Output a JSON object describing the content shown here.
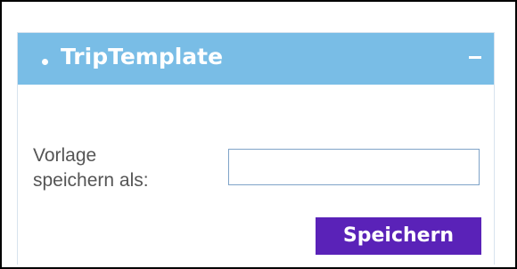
{
  "panel": {
    "title": "TripTemplate",
    "collapse_icon": "minus-icon"
  },
  "form": {
    "label": "Vorlage\nspeichern als:",
    "input_value": "",
    "input_placeholder": "",
    "save_label": "Speichern"
  },
  "colors": {
    "header_background": "#79bde6",
    "button_background": "#5a22b8",
    "input_border": "#7fa3c8",
    "frame_border": "#000000"
  }
}
